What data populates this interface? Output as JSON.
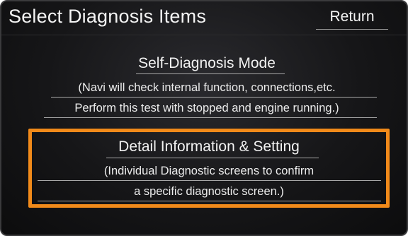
{
  "screen": {
    "title": "Select Diagnosis Items",
    "return_label": "Return"
  },
  "options": [
    {
      "label": "Self-Diagnosis Mode",
      "description_lines": [
        "(Navi will check internal function, connections,etc.",
        "Perform this test with stopped and engine running.)"
      ],
      "highlighted": false
    },
    {
      "label": "Detail Information & Setting",
      "description_lines": [
        "(Individual Diagnostic screens to confirm",
        "a specific diagnostic screen.)"
      ],
      "highlighted": true
    }
  ],
  "colors": {
    "background": "#161618",
    "text": "#f2f2f2",
    "highlight": "#f18a1a"
  }
}
